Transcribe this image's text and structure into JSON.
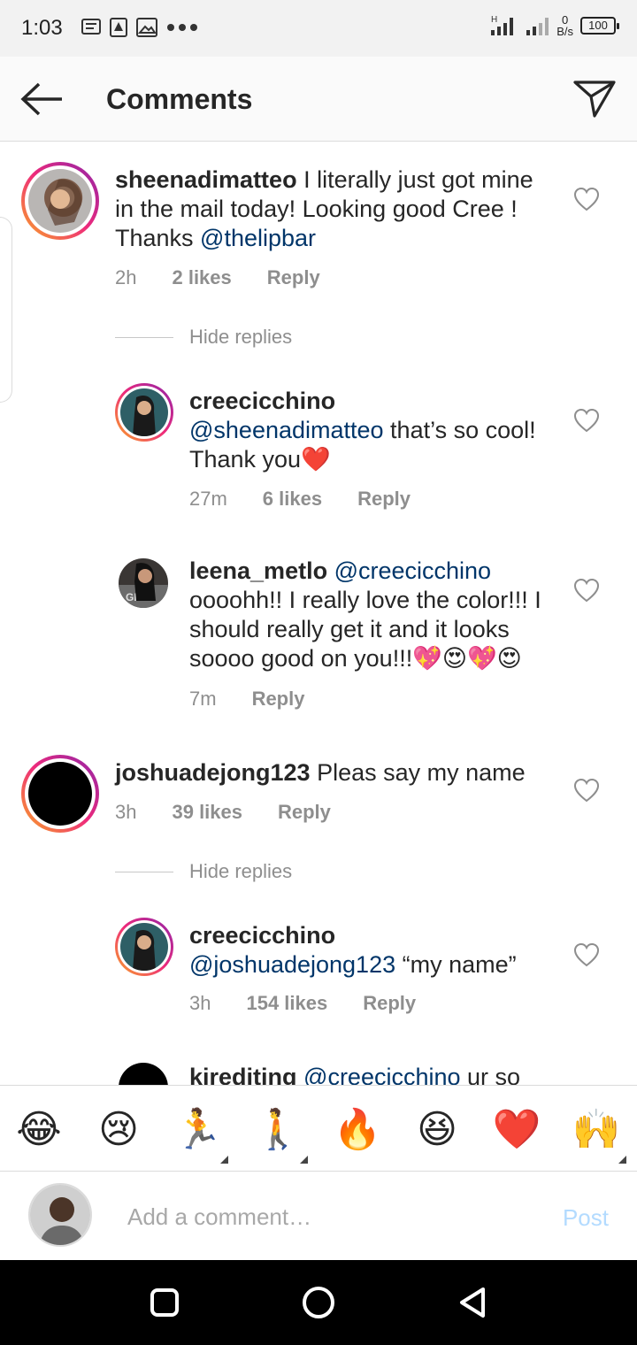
{
  "status_bar": {
    "time": "1:03",
    "net_speed_value": "0",
    "net_speed_unit": "B/s",
    "battery": "100",
    "signal_label": "H"
  },
  "header": {
    "title": "Comments",
    "back_icon": "arrow-left-icon",
    "send_icon": "paper-plane-icon"
  },
  "comments": [
    {
      "username": "sheenadimatteo",
      "text_before": " I literally just got mine in the mail today! Looking good Cree ! Thanks ",
      "mention": "@thelipbar",
      "text_after": "",
      "time": "2h",
      "likes": "2 likes",
      "reply": "Reply",
      "hide_replies": "Hide replies"
    },
    {
      "username": "creecicchino",
      "mention": "@sheenadimatteo",
      "text_after": " that’s so cool! Thank you❤️",
      "time": "27m",
      "likes": "6 likes",
      "reply": "Reply"
    },
    {
      "username": "leena_metlo",
      "mention": "@creecicchino",
      "text_after": "oooohh!! I really love the color!!! I should really get it and it looks soooo good on you!!!💖😍💖😍",
      "time": "7m",
      "reply": "Reply"
    },
    {
      "username": "joshuadejong123",
      "text_before": " Pleas say my name",
      "time": "3h",
      "likes": "39 likes",
      "reply": "Reply",
      "hide_replies": "Hide replies"
    },
    {
      "username": "creecicchino",
      "mention": "@joshuadejong123",
      "text_after": " “my name”",
      "time": "3h",
      "likes": "154 likes",
      "reply": "Reply"
    },
    {
      "username": "kirediting",
      "mention": "@creecicchino",
      "text_after": " ur so"
    }
  ],
  "emoji_bar": [
    "😂",
    "😢",
    "🏃",
    "🚶",
    "🔥",
    "😆",
    "❤️",
    "🙌"
  ],
  "input": {
    "placeholder": "Add a comment…",
    "post_label": "Post"
  },
  "colors": {
    "mention": "#003569",
    "meta": "#8e8e8e",
    "post_disabled": "#b3dbff",
    "heart_red": "#e0245e"
  }
}
